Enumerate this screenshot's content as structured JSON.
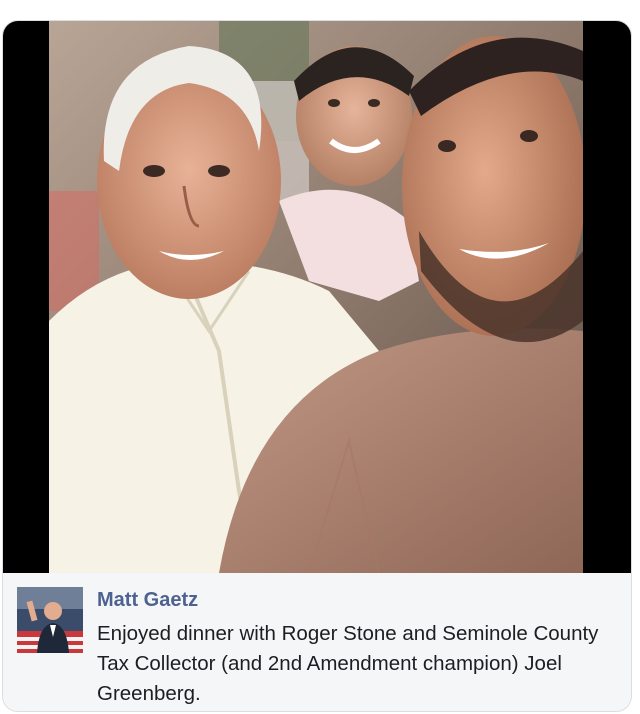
{
  "post": {
    "author_name": "Matt Gaetz",
    "text": "Enjoyed dinner with Roger Stone and Seminole County Tax Collector (and 2nd Amendment champion) Joel Greenberg."
  },
  "icons": {
    "avatar": "author-profile-photo"
  },
  "colors": {
    "author_link": "#4e6291",
    "footer_bg": "#f5f6f7",
    "body_text": "#1c1e21"
  }
}
